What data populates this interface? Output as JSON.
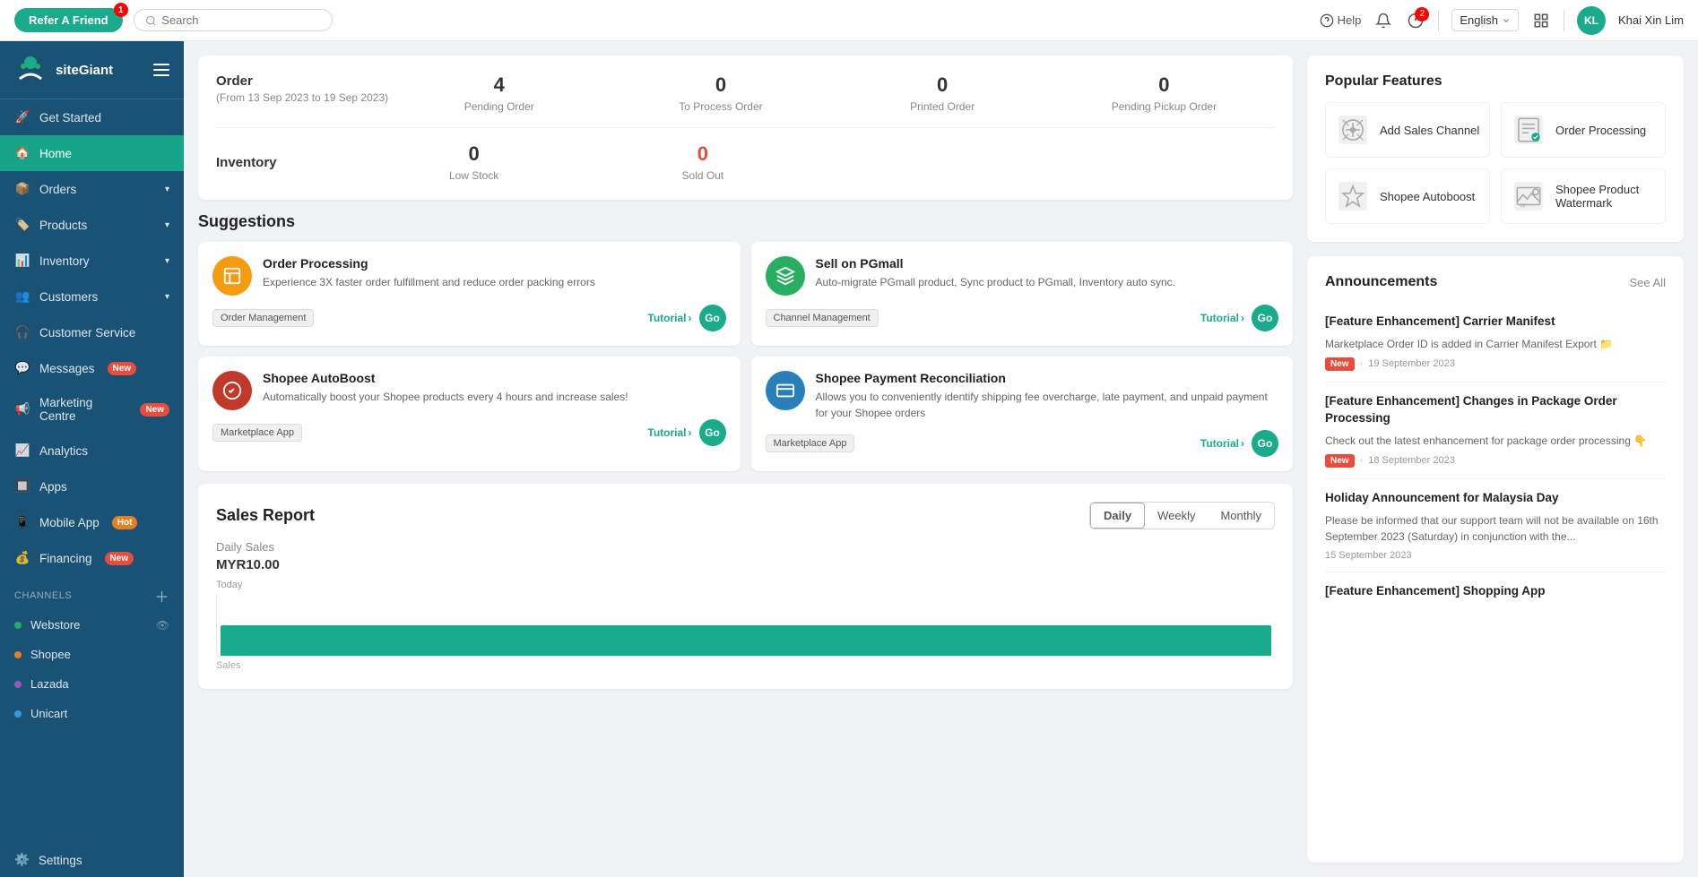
{
  "topbar": {
    "refer_label": "Refer A Friend",
    "refer_badge": "1",
    "search_placeholder": "Search",
    "help_label": "Help",
    "notif_badge": "2",
    "lang_label": "English",
    "user_initials": "KL",
    "user_name": "Khai Xin Lim"
  },
  "sidebar": {
    "logo_text": "siteGiant",
    "nav_items": [
      {
        "id": "get-started",
        "label": "Get Started",
        "icon": "rocket"
      },
      {
        "id": "home",
        "label": "Home",
        "icon": "home",
        "active": true
      },
      {
        "id": "orders",
        "label": "Orders",
        "icon": "orders",
        "has_arrow": true
      },
      {
        "id": "products",
        "label": "Products",
        "icon": "products",
        "has_arrow": true
      },
      {
        "id": "inventory",
        "label": "Inventory",
        "icon": "inventory",
        "has_arrow": true
      },
      {
        "id": "customers",
        "label": "Customers",
        "icon": "customers",
        "has_arrow": true
      },
      {
        "id": "customer-service",
        "label": "Customer Service",
        "icon": "customer-service"
      },
      {
        "id": "messages",
        "label": "Messages",
        "icon": "messages",
        "badge": "New",
        "badge_type": "new"
      },
      {
        "id": "marketing-centre",
        "label": "Marketing Centre",
        "icon": "marketing",
        "badge": "New",
        "badge_type": "new"
      },
      {
        "id": "analytics",
        "label": "Analytics",
        "icon": "analytics"
      },
      {
        "id": "apps",
        "label": "Apps",
        "icon": "apps"
      },
      {
        "id": "mobile-app",
        "label": "Mobile App",
        "icon": "mobile",
        "badge": "Hot",
        "badge_type": "hot"
      },
      {
        "id": "financing",
        "label": "Financing",
        "icon": "financing",
        "badge": "New",
        "badge_type": "new"
      }
    ],
    "channels_label": "CHANNELS",
    "channels": [
      {
        "id": "webstore",
        "label": "Webstore",
        "color": "webstore",
        "has_eye": true
      },
      {
        "id": "shopee",
        "label": "Shopee",
        "color": "shopee"
      },
      {
        "id": "lazada",
        "label": "Lazada",
        "color": "lazada"
      },
      {
        "id": "unicart",
        "label": "Unicart",
        "color": "unicart"
      }
    ],
    "settings_label": "Settings"
  },
  "order_stats": {
    "title": "Order",
    "date_range": "(From 13 Sep 2023 to 19 Sep 2023)",
    "items": [
      {
        "value": "4",
        "label": "Pending Order"
      },
      {
        "value": "0",
        "label": "To Process Order"
      },
      {
        "value": "0",
        "label": "Printed Order"
      },
      {
        "value": "0",
        "label": "Pending Pickup Order"
      }
    ]
  },
  "inventory_stats": {
    "title": "Inventory",
    "items": [
      {
        "value": "0",
        "label": "Low Stock",
        "red": false
      },
      {
        "value": "0",
        "label": "Sold Out",
        "red": true
      }
    ]
  },
  "suggestions": {
    "title": "Suggestions",
    "items": [
      {
        "id": "order-processing",
        "icon_color": "orange",
        "icon_emoji": "📋",
        "title": "Order Processing",
        "desc": "Experience 3X faster order fulfillment and reduce order packing errors",
        "tag": "Order Management",
        "tutorial": "Tutorial",
        "go": "Go"
      },
      {
        "id": "sell-on-pgmall",
        "icon_color": "green",
        "icon_emoji": "🚀",
        "title": "Sell on PGmall",
        "desc": "Auto-migrate PGmall product, Sync product to PGmall, Inventory auto sync.",
        "tag": "Channel Management",
        "tutorial": "Tutorial",
        "go": "Go"
      },
      {
        "id": "shopee-autoboost",
        "icon_color": "red",
        "icon_emoji": "🎯",
        "title": "Shopee AutoBoost",
        "desc": "Automatically boost your Shopee products every 4 hours and increase sales!",
        "tag": "Marketplace App",
        "tutorial": "Tutorial",
        "go": "Go"
      },
      {
        "id": "shopee-payment",
        "icon_color": "blue",
        "icon_emoji": "💳",
        "title": "Shopee Payment Reconciliation",
        "desc": "Allows you to conveniently identify shipping fee overcharge, late payment, and unpaid payment for your Shopee orders",
        "tag": "Marketplace App",
        "tutorial": "Tutorial",
        "go": "Go"
      }
    ]
  },
  "sales_report": {
    "title": "Sales Report",
    "period_buttons": [
      "Daily",
      "Weekly",
      "Monthly"
    ],
    "active_period": "Daily",
    "subtitle": "Daily Sales",
    "amount": "MYR10.00",
    "chart_label": "Today",
    "sales_axis_label": "Sales"
  },
  "popular_features": {
    "title": "Popular Features",
    "items": [
      {
        "id": "add-sales-channel",
        "label": "Add Sales Channel",
        "icon": "gear"
      },
      {
        "id": "order-processing",
        "label": "Order Processing",
        "icon": "orders2"
      },
      {
        "id": "shopee-autoboost",
        "label": "Shopee Autoboost",
        "icon": "rocket2"
      },
      {
        "id": "shopee-product-watermark",
        "label": "Shopee Product Watermark",
        "icon": "watermark"
      }
    ]
  },
  "announcements": {
    "title": "Announcements",
    "see_all": "See All",
    "items": [
      {
        "id": "carrier-manifest",
        "title": "[Feature Enhancement] Carrier Manifest",
        "desc": "Marketplace Order ID is added in Carrier Manifest Export 📁",
        "badge": "New",
        "date": "19 September 2023"
      },
      {
        "id": "package-order",
        "title": "[Feature Enhancement] Changes in Package Order Processing",
        "desc": "Check out the latest enhancement for package order processing 👇",
        "badge": "New",
        "date": "18 September 2023"
      },
      {
        "id": "holiday",
        "title": "Holiday Announcement for Malaysia Day",
        "desc": "Please be informed that our support team will not be available on 16th September 2023 (Saturday) in conjunction with the...",
        "date": "15 September 2023"
      },
      {
        "id": "shopping-app",
        "title": "[Feature Enhancement] Shopping App",
        "desc": "",
        "date": ""
      }
    ]
  }
}
